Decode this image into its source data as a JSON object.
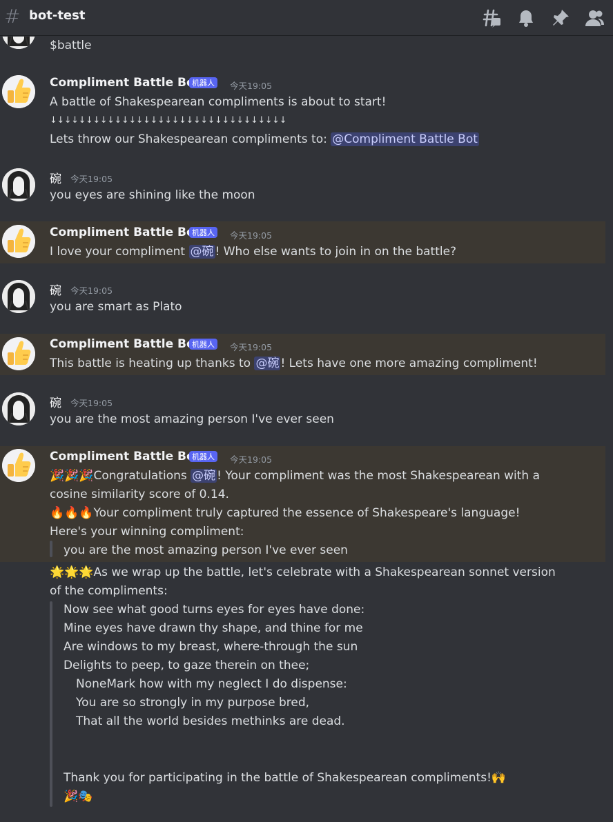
{
  "header": {
    "channel_name": "bot-test",
    "icons": [
      "threads-icon",
      "bell-icon",
      "pin-icon",
      "members-icon"
    ]
  },
  "messages": [
    {
      "type": "continuation",
      "content": "$battle"
    },
    {
      "author": "Compliment Battle Bot",
      "badge": "机器人",
      "timestamp": "今天19:05",
      "lines": [
        "A battle of Shakespearean compliments is about to start!",
        "↓↓↓↓↓↓↓↓↓↓↓↓↓↓↓↓↓↓↓↓↓↓↓↓↓↓↓↓↓↓↓↓↓",
        "Lets throw our Shakespearean compliments to: "
      ],
      "mention": "@Compliment Battle Bot"
    },
    {
      "author": "碗",
      "timestamp": "今天19:05",
      "content": "you eyes are shining like the moon"
    },
    {
      "author": "Compliment Battle Bot",
      "badge": "机器人",
      "timestamp": "今天19:05",
      "pre": "I love your compliment ",
      "mention": "@碗",
      "post": "! Who else wants to join in on the battle?"
    },
    {
      "author": "碗",
      "timestamp": "今天19:05",
      "content": "you are smart as Plato"
    },
    {
      "author": "Compliment Battle Bot",
      "badge": "机器人",
      "timestamp": "今天19:05",
      "pre": "This battle is heating up thanks to ",
      "mention": "@碗",
      "post": "! Lets have one more amazing compliment!"
    },
    {
      "author": "碗",
      "timestamp": "今天19:05",
      "content": "you are the most amazing person I've ever seen"
    },
    {
      "author": "Compliment Battle Bot",
      "badge": "机器人",
      "timestamp": "今天19:05",
      "emoji1": "🎉🎉🎉",
      "pre": "Congratulations ",
      "mention": "@碗",
      "post": "! Your compliment was the most Shakespearean with a",
      "line2": "cosine similarity score of 0.14.",
      "emoji2": "🔥🔥🔥",
      "line3": "Your compliment truly captured the essence of Shakespeare's language!",
      "line4": "Here's your winning compliment:",
      "quote": "you are the most amazing person I've ever seen"
    },
    {
      "type": "continuation",
      "emoji": "🌟🌟🌟",
      "line1": "As we wrap up the battle, let's celebrate with a Shakespearean sonnet version",
      "line2": "of the compliments:",
      "sonnet": [
        "Now see what good turns eyes for eyes have done:",
        "Mine eyes have drawn thy shape, and thine for me",
        "Are windows to my breast, where-through the sun",
        "Delights to peep, to gaze therein on thee;",
        "NoneMark how with my neglect I do dispense:",
        "You are so strongly in my purpose bred,",
        "That all the world besides methinks are dead."
      ],
      "closing": "Thank you for participating in the battle of Shakespearean compliments!",
      "closing_emoji": "🙌",
      "final_emoji": "🎉🎭"
    }
  ],
  "colors": {
    "background": "#313338",
    "highlight": "#3c3832",
    "mention_bg": "#3c4270",
    "badge": "#5865f2"
  }
}
